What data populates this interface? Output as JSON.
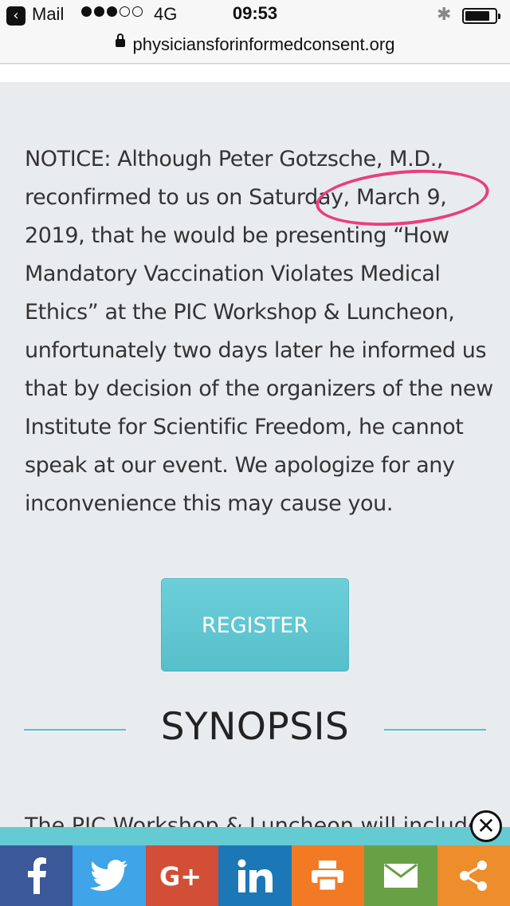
{
  "status_bar": {
    "back_label": "Mail",
    "network": "4G",
    "time": "09:53"
  },
  "url_bar": {
    "url": "physiciansforinformedconsent.org"
  },
  "content": {
    "notice": "NOTICE: Although Peter Gotzsche, M.D., reconfirmed to us on Saturday, March 9, 2019, that he would be presenting “How Mandatory Vaccination Violates Medical Ethics” at the PIC Workshop & Luncheon, unfortunately two days later he informed us that by decision of the organizers of the new Institute for Scientific Freedom, he cannot speak at our event. We apologize for any inconvenience this may cause you.",
    "register_label": "REGISTER",
    "synopsis_title": "SYNOPSIS",
    "partial_text": "The PIC Workshop & Luncheon will include"
  },
  "share_bar": {
    "items": [
      {
        "name": "facebook",
        "icon": "facebook-icon",
        "color": "#3b5998"
      },
      {
        "name": "twitter",
        "icon": "twitter-icon",
        "color": "#3fa4e8"
      },
      {
        "name": "google-plus",
        "icon": "google-plus-icon",
        "color": "#d34e36"
      },
      {
        "name": "linkedin",
        "icon": "linkedin-icon",
        "color": "#1b77b6"
      },
      {
        "name": "print",
        "icon": "printer-icon",
        "color": "#f27a24"
      },
      {
        "name": "email",
        "icon": "envelope-icon",
        "color": "#68a046"
      },
      {
        "name": "share",
        "icon": "share-icon",
        "color": "#ee8d2b"
      }
    ]
  },
  "colors": {
    "accent_teal": "#5bbfcc",
    "highlight_circle": "#e8407a",
    "page_background": "#e9ecef"
  }
}
